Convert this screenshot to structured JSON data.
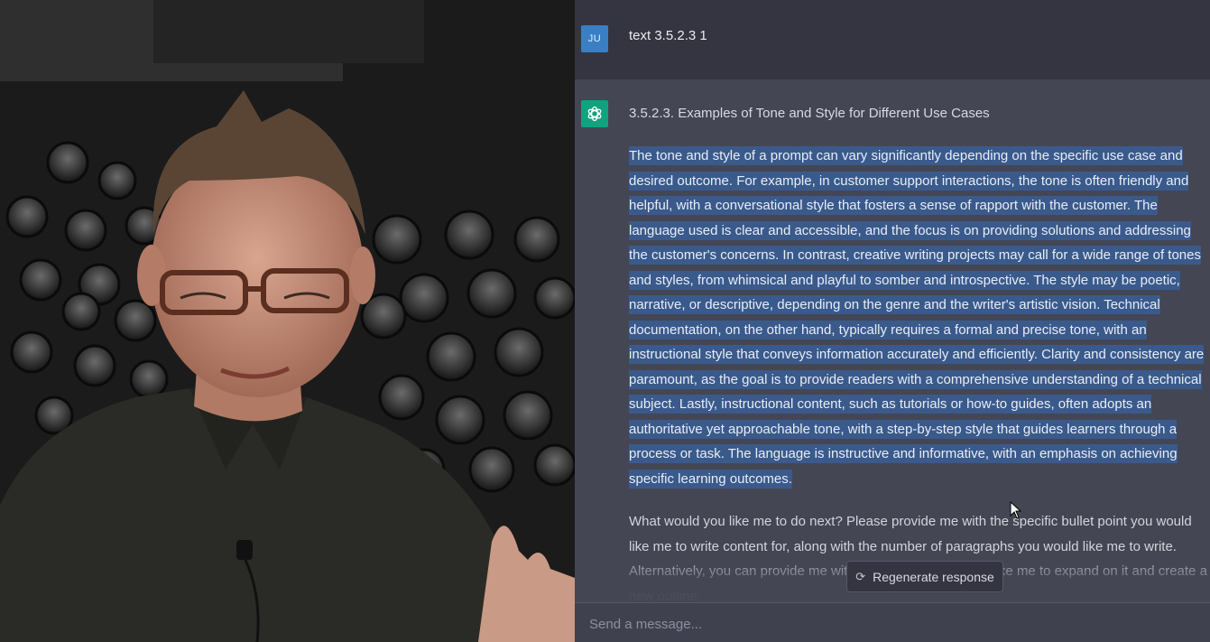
{
  "user_message": {
    "avatar_initials": "JU",
    "text": "text 3.5.2.3 1"
  },
  "assistant_message": {
    "heading": "3.5.2.3. Examples of Tone and Style for Different Use Cases",
    "selected_paragraph": "The tone and style of a prompt can vary significantly depending on the specific use case and desired outcome. For example, in customer support interactions, the tone is often friendly and helpful, with a conversational style that fosters a sense of rapport with the customer. The language used is clear and accessible, and the focus is on providing solutions and addressing the customer's concerns. In contrast, creative writing projects may call for a wide range of tones and styles, from whimsical and playful to somber and introspective. The style may be poetic, narrative, or descriptive, depending on the genre and the writer's artistic vision. Technical documentation, on the other hand, typically requires a formal and precise tone, with an instructional style that conveys information accurately and efficiently. Clarity and consistency are paramount, as the goal is to provide readers with a comprehensive understanding of a technical subject. Lastly, instructional content, such as tutorials or how-to guides, often adopts an authoritative yet approachable tone, with a step-by-step style that guides learners through a process or task. The language is instructive and informative, with an emphasis on achieving specific learning outcomes.",
    "followup_paragraph": "What would you like me to do next? Please provide me with the specific bullet point you would like me to write content for, along with the number of paragraphs you would like me to write. Alternatively, you can provide me with the section you would like me to expand on it and create a new outline."
  },
  "regenerate_button": {
    "label": "Regenerate response",
    "icon": "refresh-icon"
  },
  "composer": {
    "placeholder": "Send a message..."
  },
  "colors": {
    "user_row_bg": "#343541",
    "assistant_row_bg": "#444654",
    "selection": "#3a5a8c",
    "bot_avatar": "#10a37f",
    "user_avatar": "#3a7fc4"
  }
}
